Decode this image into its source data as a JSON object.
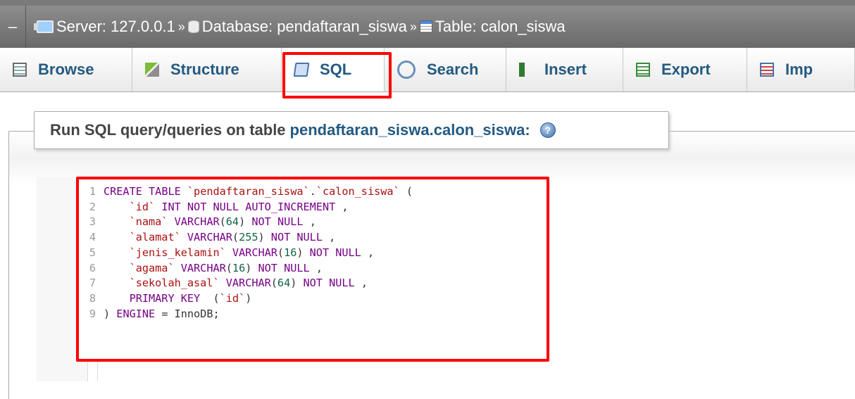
{
  "breadcrumb": {
    "collapse": "–",
    "server_label": "Server: 127.0.0.1",
    "sep1": "»",
    "database_label": "Database: pendaftaran_siswa",
    "sep2": "»",
    "table_label": "Table: calon_siswa",
    "icons": [
      "server-icon",
      "database-icon",
      "table-icon"
    ]
  },
  "tabs": [
    {
      "label": "Browse",
      "icon": "browse-icon"
    },
    {
      "label": "Structure",
      "icon": "structure-icon"
    },
    {
      "label": "SQL",
      "icon": "sql-icon",
      "active": true
    },
    {
      "label": "Search",
      "icon": "search-icon"
    },
    {
      "label": "Insert",
      "icon": "insert-icon"
    },
    {
      "label": "Export",
      "icon": "export-icon"
    },
    {
      "label": "Imp",
      "icon": "import-icon"
    }
  ],
  "query_panel": {
    "legend_prefix": "Run SQL query/queries on table",
    "legend_table": "pendaftaran_siswa.calon_siswa:",
    "help_icon": "help-icon"
  },
  "editor": {
    "line_numbers": [
      "1",
      "2",
      "3",
      "4",
      "5",
      "6",
      "7",
      "8",
      "9"
    ],
    "lines": [
      "CREATE TABLE `pendaftaran_siswa`.`calon_siswa` (",
      "    `id` INT NOT NULL AUTO_INCREMENT ,",
      "    `nama` VARCHAR(64) NOT NULL ,",
      "    `alamat` VARCHAR(255) NOT NULL ,",
      "    `jenis_kelamin` VARCHAR(16) NOT NULL ,",
      "    `agama` VARCHAR(16) NOT NULL ,",
      "    `sekolah_asal` VARCHAR(64) NOT NULL ,",
      "    PRIMARY KEY  (`id`)",
      ") ENGINE = InnoDB;"
    ]
  },
  "colors": {
    "highlight": "#ff0000",
    "link": "#235a81",
    "keyword": "#770088",
    "identifier": "#aa1111"
  }
}
